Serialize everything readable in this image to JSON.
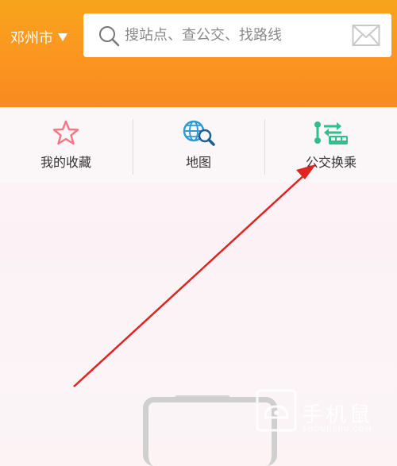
{
  "header": {
    "city": "邓州市",
    "search_placeholder": "搜站点、查公交、找路线"
  },
  "quick_actions": [
    {
      "label": "我的收藏",
      "icon": "star-icon"
    },
    {
      "label": "地图",
      "icon": "globe-search-icon"
    },
    {
      "label": "公交换乘",
      "icon": "bus-transfer-icon"
    }
  ],
  "annotation": {
    "type": "red-arrow",
    "target": "公交换乘"
  },
  "watermark": {
    "brand": "手机鼠",
    "url": "SHOUJISHU.COM"
  },
  "colors": {
    "header_orange": "#fb9520",
    "star": "#f07a86",
    "globe": "#2e9bd6",
    "transfer": "#2fbf8c",
    "arrow": "#e0241f"
  }
}
